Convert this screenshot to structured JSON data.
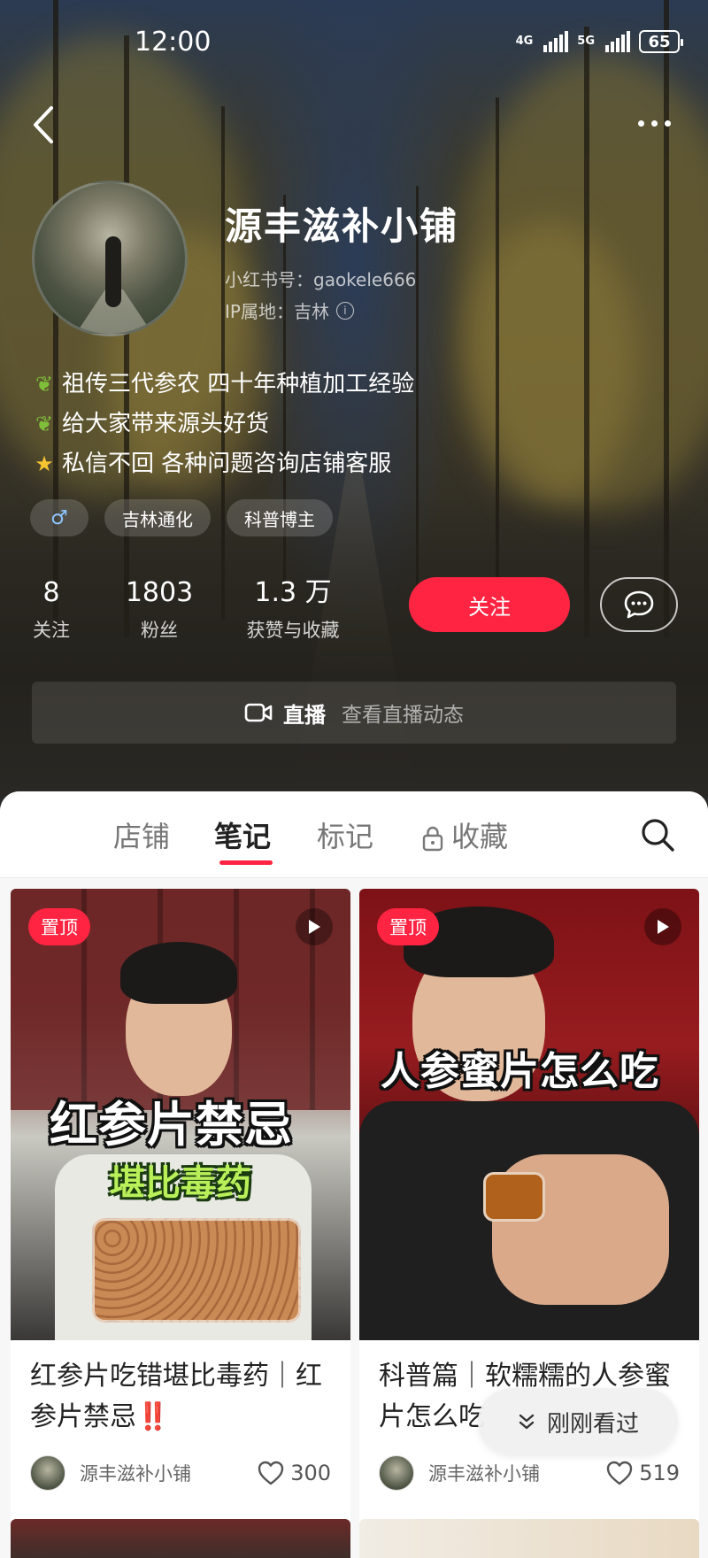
{
  "status_bar": {
    "time": "12:00",
    "network_1": "4G",
    "network_2": "5G",
    "battery": "65"
  },
  "profile": {
    "name": "源丰滋补小铺",
    "red_id": "小红书号：gaokele666",
    "ip_location": "IP属地：吉林",
    "bio": [
      {
        "icon": "leaf-icon",
        "text": "祖传三代参农  四十年种植加工经验"
      },
      {
        "icon": "leaf-icon",
        "text": "给大家带来源头好货"
      },
      {
        "icon": "star-icon",
        "text": "私信不回 各种问题咨询店铺客服"
      }
    ],
    "gender_tag": "♂",
    "tags": [
      "吉林通化",
      "科普博主"
    ]
  },
  "stats": [
    {
      "value": "8",
      "label": "关注"
    },
    {
      "value": "1803",
      "label": "粉丝"
    },
    {
      "value": "1.3 万",
      "label": "获赞与收藏"
    }
  ],
  "actions": {
    "follow": "关注"
  },
  "live": {
    "label": "直播",
    "sub": "查看直播动态"
  },
  "tabs": [
    "店铺",
    "笔记",
    "标记",
    "收藏"
  ],
  "active_tab": "笔记",
  "notes": [
    {
      "badge": "置顶",
      "overlay_title": "红参片禁忌",
      "overlay_sub": "堪比毒药",
      "title": "红参片吃错堪比毒药｜红参片禁忌",
      "title_suffix": "‼️",
      "author": "源丰滋补小铺",
      "likes": "300"
    },
    {
      "badge": "置顶",
      "overlay_title": "人参蜜片怎么吃",
      "title": "科普篇｜软糯糯的人参蜜片怎么吃",
      "author": "源丰滋补小铺",
      "likes": "519"
    }
  ],
  "recently_viewed": "刚刚看过",
  "colors": {
    "accent": "#ff2442",
    "panel_bg": "#f7f7f7"
  }
}
